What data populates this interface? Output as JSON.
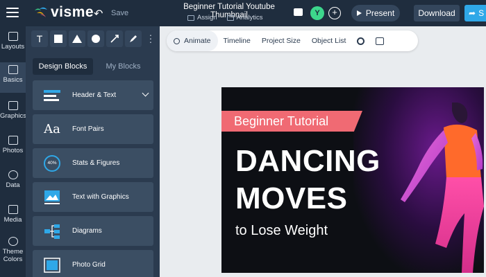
{
  "topbar": {
    "logo": "visme",
    "save_label": "Save",
    "doc_title": "Beginner Tutorial Youtube Thumbnail",
    "assign_label": "Assign",
    "analytics_label": "Analytics",
    "avatar_initial": "Y",
    "present_label": "Present",
    "download_label": "Download",
    "share_label": "S"
  },
  "rail": {
    "items": [
      {
        "label": "Layouts",
        "icon": "layouts-icon"
      },
      {
        "label": "Basics",
        "icon": "basics-icon"
      },
      {
        "label": "Graphics",
        "icon": "graphics-icon"
      },
      {
        "label": "Photos",
        "icon": "photos-icon"
      },
      {
        "label": "Data",
        "icon": "data-icon"
      },
      {
        "label": "Media",
        "icon": "media-icon"
      },
      {
        "label": "Theme",
        "label2": "Colors",
        "icon": "palette-icon"
      }
    ]
  },
  "panel": {
    "tools": [
      {
        "label": "T",
        "icon": "text-tool-icon"
      },
      {
        "icon": "square-tool-icon"
      },
      {
        "icon": "triangle-tool-icon"
      },
      {
        "icon": "circle-tool-icon"
      },
      {
        "icon": "line-tool-icon"
      },
      {
        "icon": "pen-tool-icon"
      }
    ],
    "tabs": [
      "Design Blocks",
      "My Blocks"
    ],
    "blocks": [
      {
        "label": "Header & Text",
        "icon": "header-text-icon"
      },
      {
        "label": "Font Pairs",
        "icon": "font-pairs-icon",
        "glyph": "Aa"
      },
      {
        "label": "Stats & Figures",
        "icon": "stats-icon",
        "glyph": "40%"
      },
      {
        "label": "Text with Graphics",
        "icon": "text-graphics-icon"
      },
      {
        "label": "Diagrams",
        "icon": "diagram-icon"
      },
      {
        "label": "Photo Grid",
        "icon": "photo-grid-icon"
      }
    ]
  },
  "toolbar": {
    "animate_label": "Animate",
    "timeline_label": "Timeline",
    "project_size_label": "Project Size",
    "object_list_label": "Object List"
  },
  "slide": {
    "banner": "Beginner Tutorial",
    "title_line1": "DANCING",
    "title_line2": "MOVES",
    "subtitle": "to Lose Weight"
  },
  "colors": {
    "topbar_bg": "#1f2d3e",
    "panel_bg": "#2b3b4f",
    "accent_blue": "#2fa8e8",
    "banner_pink": "#f06a73",
    "avatar_green": "#3dd68c"
  }
}
